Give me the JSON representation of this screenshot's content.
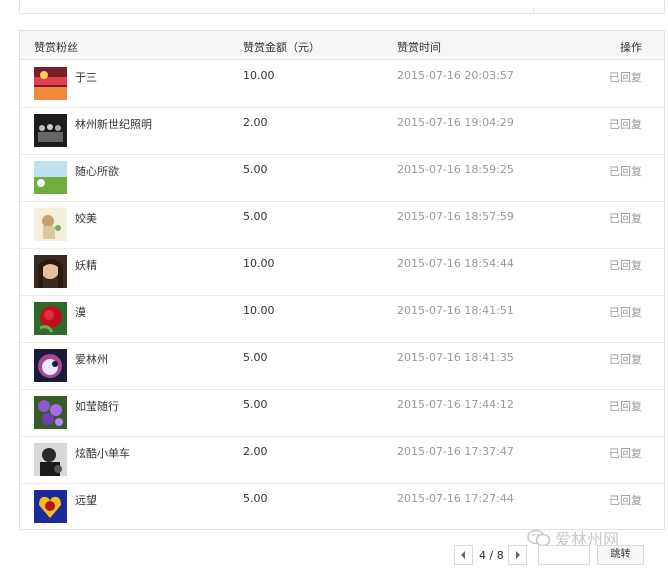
{
  "header": {
    "fan": "赞赏粉丝",
    "amount": "赞赏金额（元）",
    "time": "赞赏时间",
    "action": "操作"
  },
  "rows": [
    {
      "name": "于三",
      "amount": "10.00",
      "time": "2015-07-16 20:03:57",
      "action": "已回复"
    },
    {
      "name": "林州新世纪照明",
      "amount": "2.00",
      "time": "2015-07-16 19:04:29",
      "action": "已回复"
    },
    {
      "name": "随心所欲",
      "amount": "5.00",
      "time": "2015-07-16 18:59:25",
      "action": "已回复"
    },
    {
      "name": "姣美",
      "amount": "5.00",
      "time": "2015-07-16 18:57:59",
      "action": "已回复"
    },
    {
      "name": "妖精",
      "amount": "10.00",
      "time": "2015-07-16 18:54:44",
      "action": "已回复"
    },
    {
      "name": "漠",
      "amount": "10.00",
      "time": "2015-07-16 18:41:51",
      "action": "已回复"
    },
    {
      "name": "爱林州",
      "amount": "5.00",
      "time": "2015-07-16 18:41:35",
      "action": "已回复"
    },
    {
      "name": "如莹随行",
      "amount": "5.00",
      "time": "2015-07-16 17:44:12",
      "action": "已回复"
    },
    {
      "name": "炫酷小单车",
      "amount": "2.00",
      "time": "2015-07-16 17:37:47",
      "action": "已回复"
    },
    {
      "name": "远望",
      "amount": "5.00",
      "time": "2015-07-16 17:27:44",
      "action": "已回复"
    }
  ],
  "pagination": {
    "page_text": "4 / 8",
    "prev_icon": "caret-left-icon",
    "next_icon": "caret-right-icon",
    "jump_label": "跳转"
  },
  "watermark": {
    "text": "爱林州网"
  }
}
